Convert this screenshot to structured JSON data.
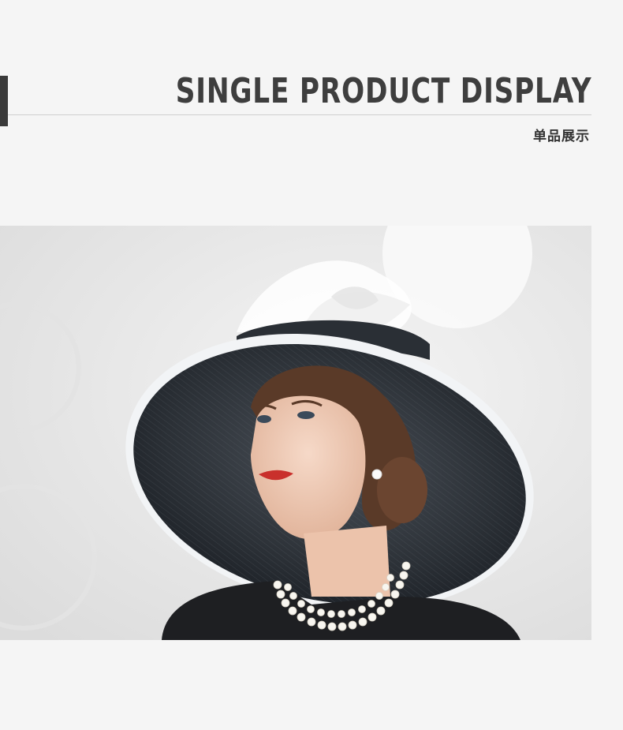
{
  "header": {
    "title": "SINGLE PRODUCT DISPLAY",
    "subtitle": "单品展示"
  },
  "colors": {
    "background": "#f5f5f5",
    "accent": "#3a3a3a",
    "title": "#3e3e3e"
  },
  "photo": {
    "subject": "woman-wearing-wide-brim-sinamay-hat"
  }
}
